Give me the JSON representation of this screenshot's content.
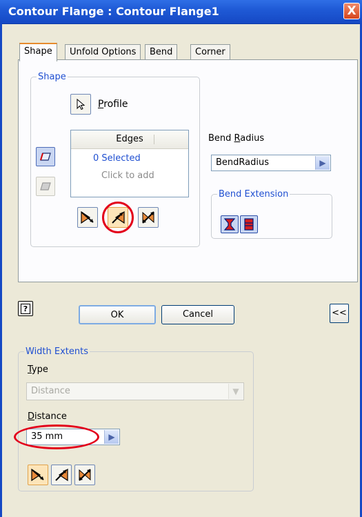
{
  "window": {
    "title": "Contour Flange : Contour Flange1",
    "close_glyph": "X"
  },
  "tabs": [
    {
      "label": "Shape",
      "active": true
    },
    {
      "label": "Unfold Options",
      "active": false
    },
    {
      "label": "Bend",
      "active": false
    },
    {
      "label": "Corner",
      "active": false
    }
  ],
  "shape_group": {
    "legend": "Shape",
    "profile_label": "Profile",
    "profile_access_key": "P",
    "edges": {
      "header": "Edges",
      "selected": "0 Selected",
      "hint": "Click to add"
    }
  },
  "bend_radius": {
    "label": "Bend Radius",
    "access_key": "R",
    "value": "BendRadius"
  },
  "bend_extension": {
    "legend": "Bend Extension"
  },
  "buttons": {
    "help": "?",
    "ok": "OK",
    "cancel": "Cancel",
    "collapse": "<<"
  },
  "width_extents": {
    "legend": "Width Extents",
    "type_label": "Type",
    "type_value": "Distance",
    "distance_label": "Distance",
    "distance_value": "35 mm"
  },
  "colors": {
    "accent": "#1f4fd1",
    "highlight_ring": "#e3001b",
    "title_bar": "#1f5ad6"
  }
}
